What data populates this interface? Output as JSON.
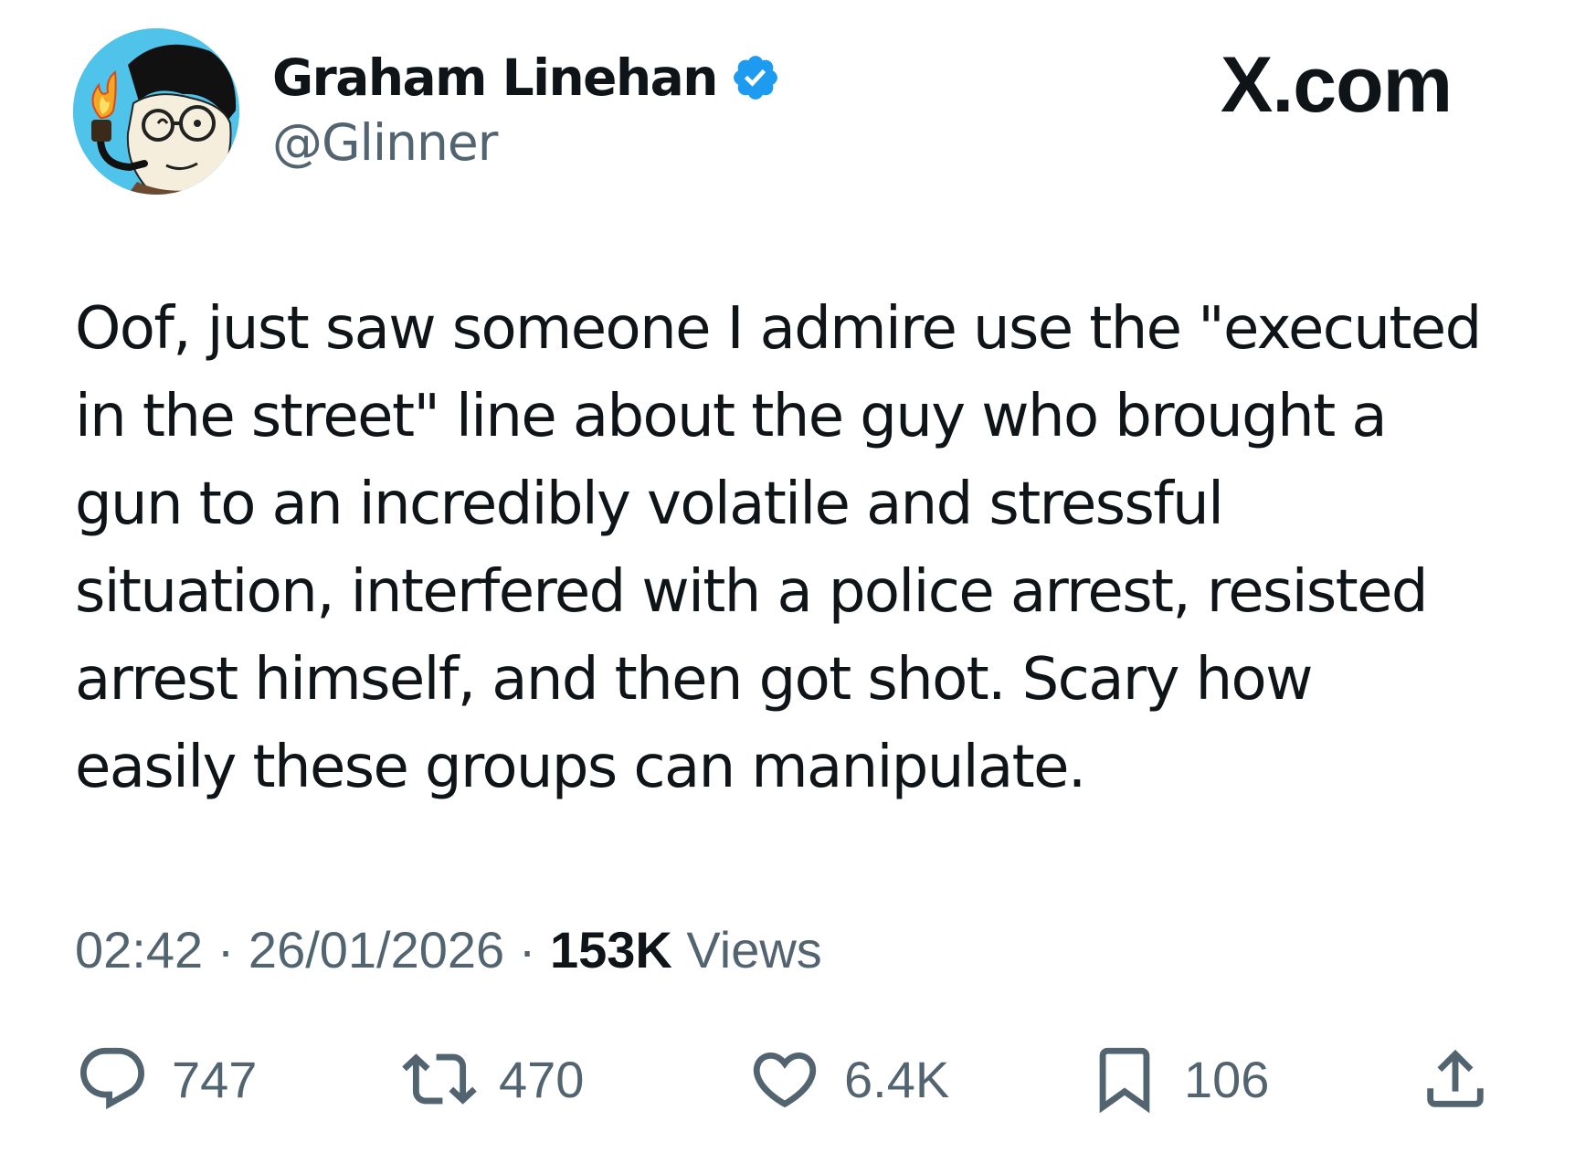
{
  "author": {
    "display_name": "Graham Linehan",
    "handle": "@Glinner",
    "verified": true,
    "verified_color": "#1d9bf0"
  },
  "brand": {
    "label": "X.com"
  },
  "tweet": {
    "text": "Oof, just saw someone I admire use the \"executed\nin the street\" line about the guy who brought a\ngun to an incredibly volatile and stressful\nsituation, interfered with a police arrest, resisted\narrest himself, and then got shot. Scary how\neasily these groups can manipulate."
  },
  "meta": {
    "time": "02:42",
    "separator": "·",
    "date": "26/01/2026",
    "views_count": "153K",
    "views_label": "Views"
  },
  "actions": {
    "replies": {
      "icon": "reply-icon",
      "count": "747"
    },
    "reposts": {
      "icon": "repost-icon",
      "count": "470"
    },
    "likes": {
      "icon": "heart-icon",
      "count": "6.4K"
    },
    "bookmarks": {
      "icon": "bookmark-icon",
      "count": "106"
    },
    "share": {
      "icon": "share-icon"
    }
  },
  "colors": {
    "text_primary": "#0f1419",
    "text_secondary": "#536471",
    "avatar_background": "#4fc3ea"
  }
}
